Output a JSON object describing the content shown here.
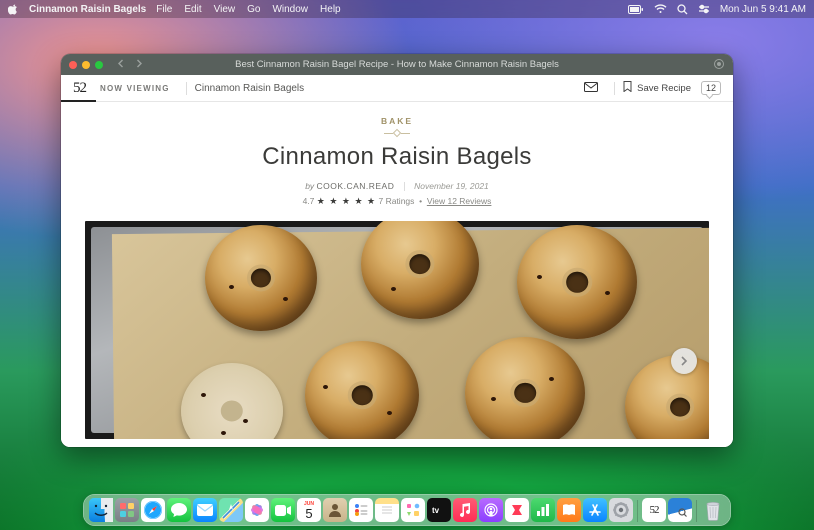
{
  "menubar": {
    "app_name": "Cinnamon Raisin Bagels",
    "items": [
      "File",
      "Edit",
      "View",
      "Go",
      "Window",
      "Help"
    ],
    "clock": "Mon Jun 5 9:41 AM"
  },
  "window": {
    "title": "Best Cinnamon Raisin Bagel Recipe - How to Make Cinnamon Raisin Bagels"
  },
  "topbar": {
    "logo": "52",
    "now_viewing_label": "NOW VIEWING",
    "crumb": "Cinnamon Raisin Bagels",
    "save_label": "Save Recipe",
    "comment_count": "12"
  },
  "recipe": {
    "category": "BAKE",
    "title": "Cinnamon Raisin Bagels",
    "by_label": "by",
    "author": "COOK.CAN.READ",
    "date": "November 19, 2021",
    "rating_value": "4.7",
    "stars": "★ ★ ★ ★ ★",
    "ratings_count_label": "7 Ratings",
    "reviews_link": "View 12 Reviews"
  },
  "dock": {
    "apps": [
      "finder",
      "launchpad",
      "safari",
      "messages",
      "mail",
      "maps",
      "photos",
      "facetime",
      "calendar",
      "contacts",
      "reminders",
      "notes",
      "freeform",
      "tv",
      "music",
      "podcasts",
      "news",
      "books",
      "appstore",
      "settings"
    ],
    "pinned": [
      "food52",
      "preview"
    ],
    "trash": "trash",
    "calendar_day": "5",
    "calendar_month": "JUN"
  }
}
